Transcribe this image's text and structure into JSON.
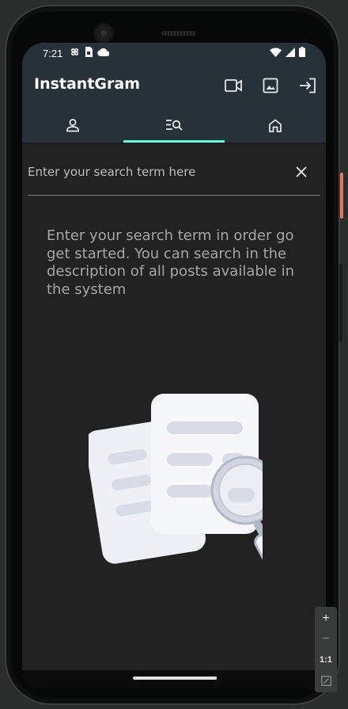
{
  "status_bar": {
    "time": "7:21",
    "left_icons": [
      "pinwheel-icon",
      "sim-card-icon",
      "cloud-icon"
    ],
    "right_icons": [
      "wifi-icon",
      "signal-icon",
      "battery-icon"
    ]
  },
  "app_bar": {
    "title": "InstantGram",
    "actions": [
      "video-camera-icon",
      "image-icon",
      "login-icon"
    ],
    "background": "#263238"
  },
  "tabs": [
    {
      "icon": "person-icon",
      "selected": false
    },
    {
      "icon": "search-list-icon",
      "selected": true
    },
    {
      "icon": "home-icon",
      "selected": false
    }
  ],
  "tab_indicator_color": "#64ffda",
  "search": {
    "placeholder": "Enter your search term here",
    "value": ""
  },
  "empty_state": {
    "message": "Enter your search term in order go get started. You can search in the description of all posts available in the system",
    "illustration": "documents-magnifier-illustration"
  },
  "emulator_controls": {
    "zoom_in": "+",
    "zoom_out": "−",
    "actual_size": "1:1",
    "fit_icon": "fit-screen-icon"
  }
}
